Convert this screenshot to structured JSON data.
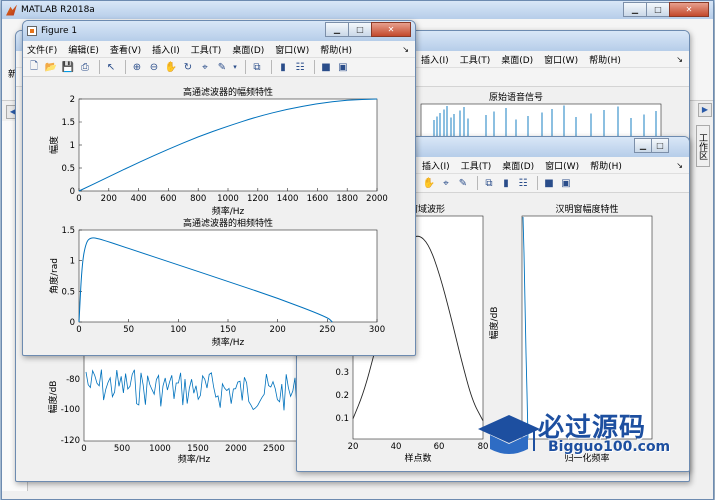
{
  "main": {
    "title": "MATLAB R2018a",
    "left_labels": [
      "新",
      "当",
      "详"
    ],
    "right_labels": [
      "工",
      "作",
      "区"
    ]
  },
  "menus": [
    "文件(F)",
    "编辑(E)",
    "查看(V)",
    "插入(I)",
    "工具(T)",
    "桌面(D)",
    "窗口(W)",
    "帮助(H)"
  ],
  "menus_short": [
    "插入(I)",
    "工具(T)",
    "桌面(D)",
    "窗口(W)",
    "帮助(H)"
  ],
  "win_controls": {
    "minimize": "▁",
    "restore": "□",
    "close": "✕"
  },
  "figure1": {
    "title": "Figure 1",
    "plot1": {
      "title": "高通滤波器的幅频特性",
      "xlabel": "频率/Hz",
      "ylabel": "幅度",
      "xticks": [
        "0",
        "200",
        "400",
        "600",
        "800",
        "1000",
        "1200",
        "1400",
        "1600",
        "1800",
        "2000"
      ],
      "yticks": [
        "0",
        "0.5",
        "1",
        "1.5",
        "2"
      ]
    },
    "plot2": {
      "title": "高通滤波器的相频特性",
      "xlabel": "频率/Hz",
      "ylabel": "角度/rad",
      "xticks": [
        "0",
        "50",
        "100",
        "150",
        "200",
        "250",
        "300"
      ],
      "yticks": [
        "0",
        "0.5",
        "1",
        "1.5"
      ]
    }
  },
  "figure_back": {
    "plot_title": "原始语音信号",
    "lower_plot": {
      "xlabel": "频率/Hz",
      "ylabel": "幅度/dB",
      "xticks": [
        "0",
        "500",
        "1000",
        "1500",
        "2000",
        "2500",
        "30"
      ],
      "yticks": [
        "-80",
        "-100",
        "-120"
      ]
    }
  },
  "figure_right": {
    "left_plot": {
      "title": "窗域波形",
      "xlabel": "样点数",
      "xticks": [
        "20",
        "40",
        "60",
        "80"
      ],
      "yticks": [
        "0.3",
        "0.2",
        "0.1"
      ]
    },
    "right_plot": {
      "title": "汉明窗幅度特性",
      "xlabel": "归一化频率",
      "ylabel": "幅度/dB"
    }
  },
  "watermark": {
    "text": "必过源码",
    "url": "Bigguo100.com"
  },
  "chart_data": [
    {
      "type": "line",
      "title": "高通滤波器的幅频特性",
      "xlabel": "频率/Hz",
      "ylabel": "幅度",
      "xlim": [
        0,
        2000
      ],
      "ylim": [
        0,
        2
      ],
      "x": [
        0,
        200,
        400,
        600,
        800,
        1000,
        1200,
        1400,
        1600,
        1800,
        2000
      ],
      "values": [
        0.0,
        0.31,
        0.62,
        0.91,
        1.18,
        1.41,
        1.62,
        1.78,
        1.9,
        1.98,
        2.0
      ]
    },
    {
      "type": "line",
      "title": "高通滤波器的相频特性",
      "xlabel": "频率/Hz",
      "ylabel": "角度/rad",
      "xlim": [
        0,
        300
      ],
      "ylim": [
        0,
        1.5
      ],
      "x": [
        0,
        3,
        7,
        12,
        20,
        50,
        100,
        150,
        200,
        250,
        255
      ],
      "values": [
        0.0,
        0.95,
        1.3,
        1.38,
        1.36,
        1.2,
        0.93,
        0.66,
        0.39,
        0.08,
        0.0
      ]
    },
    {
      "type": "line",
      "title": "",
      "xlabel": "样点数",
      "ylabel": "",
      "xlim": [
        20,
        80
      ],
      "ylim": [
        0,
        0.4
      ],
      "x": [
        20,
        25,
        30,
        35,
        40,
        45,
        50,
        55,
        60,
        65,
        70,
        75,
        80
      ],
      "values": [
        0.09,
        0.22,
        0.42,
        0.62,
        0.82,
        0.96,
        1.0,
        0.95,
        0.8,
        0.6,
        0.38,
        0.18,
        0.08
      ]
    }
  ]
}
